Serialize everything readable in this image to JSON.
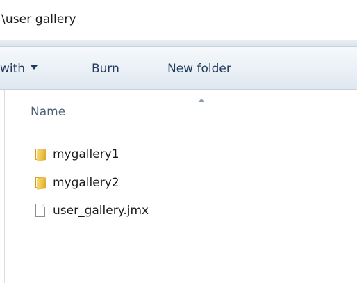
{
  "address_bar": {
    "path": "\\user gallery"
  },
  "toolbar": {
    "items": [
      {
        "label": "with",
        "has_dropdown": true
      },
      {
        "label": "Burn",
        "has_dropdown": false
      },
      {
        "label": "New folder",
        "has_dropdown": false
      }
    ]
  },
  "file_list": {
    "column_header": "Name",
    "sort": "ascending",
    "items": [
      {
        "name": "mygallery1",
        "type": "folder",
        "icon": "folder-icon"
      },
      {
        "name": "mygallery2",
        "type": "folder",
        "icon": "folder-icon"
      },
      {
        "name": "user_gallery.jmx",
        "type": "file",
        "icon": "document-icon"
      }
    ]
  },
  "colors": {
    "toolbar_text": "#1e395b",
    "header_text": "#4c607a",
    "folder": "#eec44a"
  }
}
